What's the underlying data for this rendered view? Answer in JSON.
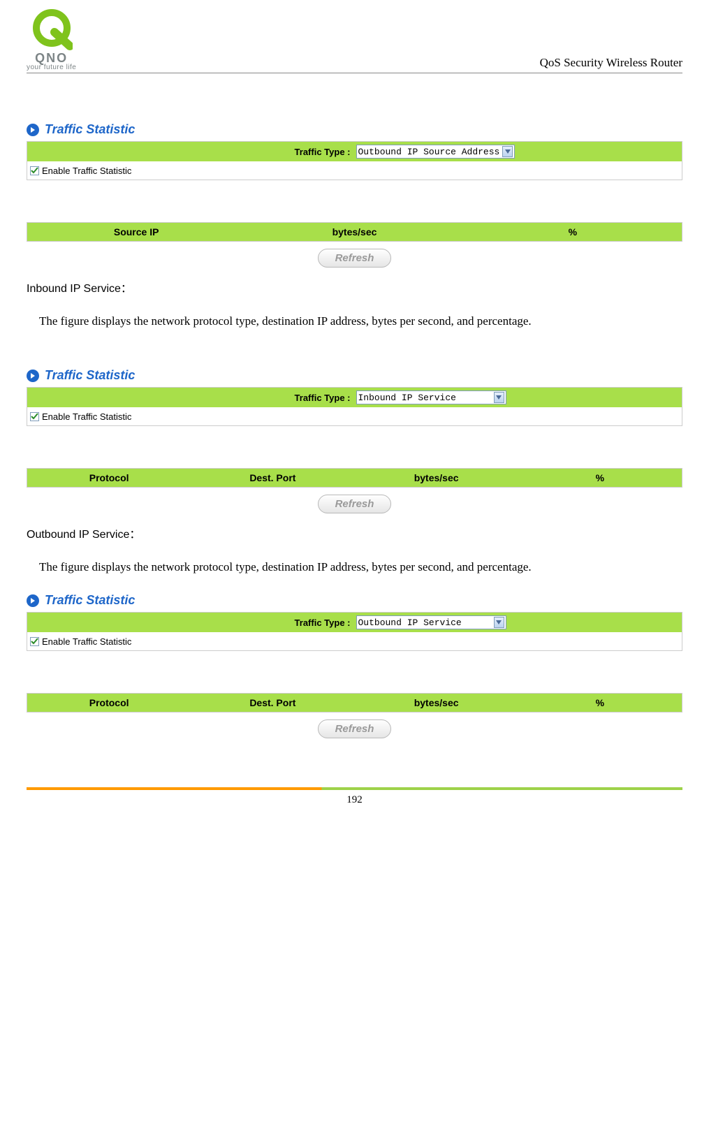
{
  "header": {
    "logo_text": "QNO",
    "logo_tagline": "your future life",
    "title": "QoS Security Wireless Router"
  },
  "panels": [
    {
      "title": "Traffic Statistic",
      "traffic_type_label": "Traffic Type :",
      "traffic_type_value": "Outbound IP Source Address",
      "enable_label": "Enable Traffic Statistic",
      "enable_checked": true,
      "columns": [
        "Source IP",
        "bytes/sec",
        "%"
      ],
      "refresh_label": "Refresh"
    },
    {
      "title": "Traffic Statistic",
      "traffic_type_label": "Traffic Type :",
      "traffic_type_value": "Inbound IP Service",
      "enable_label": "Enable Traffic Statistic",
      "enable_checked": true,
      "columns": [
        "Protocol",
        "Dest. Port",
        "bytes/sec",
        "%"
      ],
      "refresh_label": "Refresh"
    },
    {
      "title": "Traffic Statistic",
      "traffic_type_label": "Traffic Type :",
      "traffic_type_value": "Outbound IP Service",
      "enable_label": "Enable Traffic Statistic",
      "enable_checked": true,
      "columns": [
        "Protocol",
        "Dest. Port",
        "bytes/sec",
        "%"
      ],
      "refresh_label": "Refresh"
    }
  ],
  "sections": [
    {
      "heading": "Inbound IP Service：",
      "body": "The figure displays the network protocol type, destination IP address, bytes per second, and percentage."
    },
    {
      "heading": "Outbound IP Service：",
      "body": "The figure displays the network protocol type, destination IP address, bytes per second, and percentage."
    }
  ],
  "page_number": "192"
}
